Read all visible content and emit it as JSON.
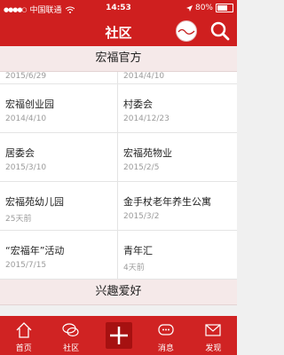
{
  "status": {
    "carrier": "中国联通",
    "time": "14:53",
    "battery": "80%",
    "battery_level": 0.8
  },
  "header": {
    "title": "社区",
    "logo_text": "宏福苑"
  },
  "sections": [
    {
      "title": "宏福官方",
      "partial_dates": [
        "2015/6/29",
        "2014/4/10"
      ],
      "items": [
        {
          "title": "宏福创业园",
          "date": "2014/4/10"
        },
        {
          "title": "村委会",
          "date": "2014/12/23"
        },
        {
          "title": "居委会",
          "date": "2015/3/10"
        },
        {
          "title": "宏福苑物业",
          "date": "2015/2/5"
        },
        {
          "title": "宏福苑幼儿园",
          "date": "25天前"
        },
        {
          "title": "金手杖老年养生公寓",
          "date": "2015/3/2"
        },
        {
          "title": "“宏福年”活动",
          "date": "2015/7/15"
        },
        {
          "title": "青年汇",
          "date": "4天前"
        }
      ]
    },
    {
      "title": "兴趣爱好"
    }
  ],
  "tabbar": {
    "items": [
      {
        "label": "首页",
        "icon": "home-icon"
      },
      {
        "label": "社区",
        "icon": "chat-icon"
      },
      {
        "label": "",
        "icon": "plus-icon"
      },
      {
        "label": "消息",
        "icon": "message-icon"
      },
      {
        "label": "发现",
        "icon": "mail-icon"
      }
    ]
  },
  "colors": {
    "brand": "#cf1f1f",
    "tabbar": "#d02323",
    "section_bg": "#f5e9e9",
    "date": "#9b9b9b"
  }
}
